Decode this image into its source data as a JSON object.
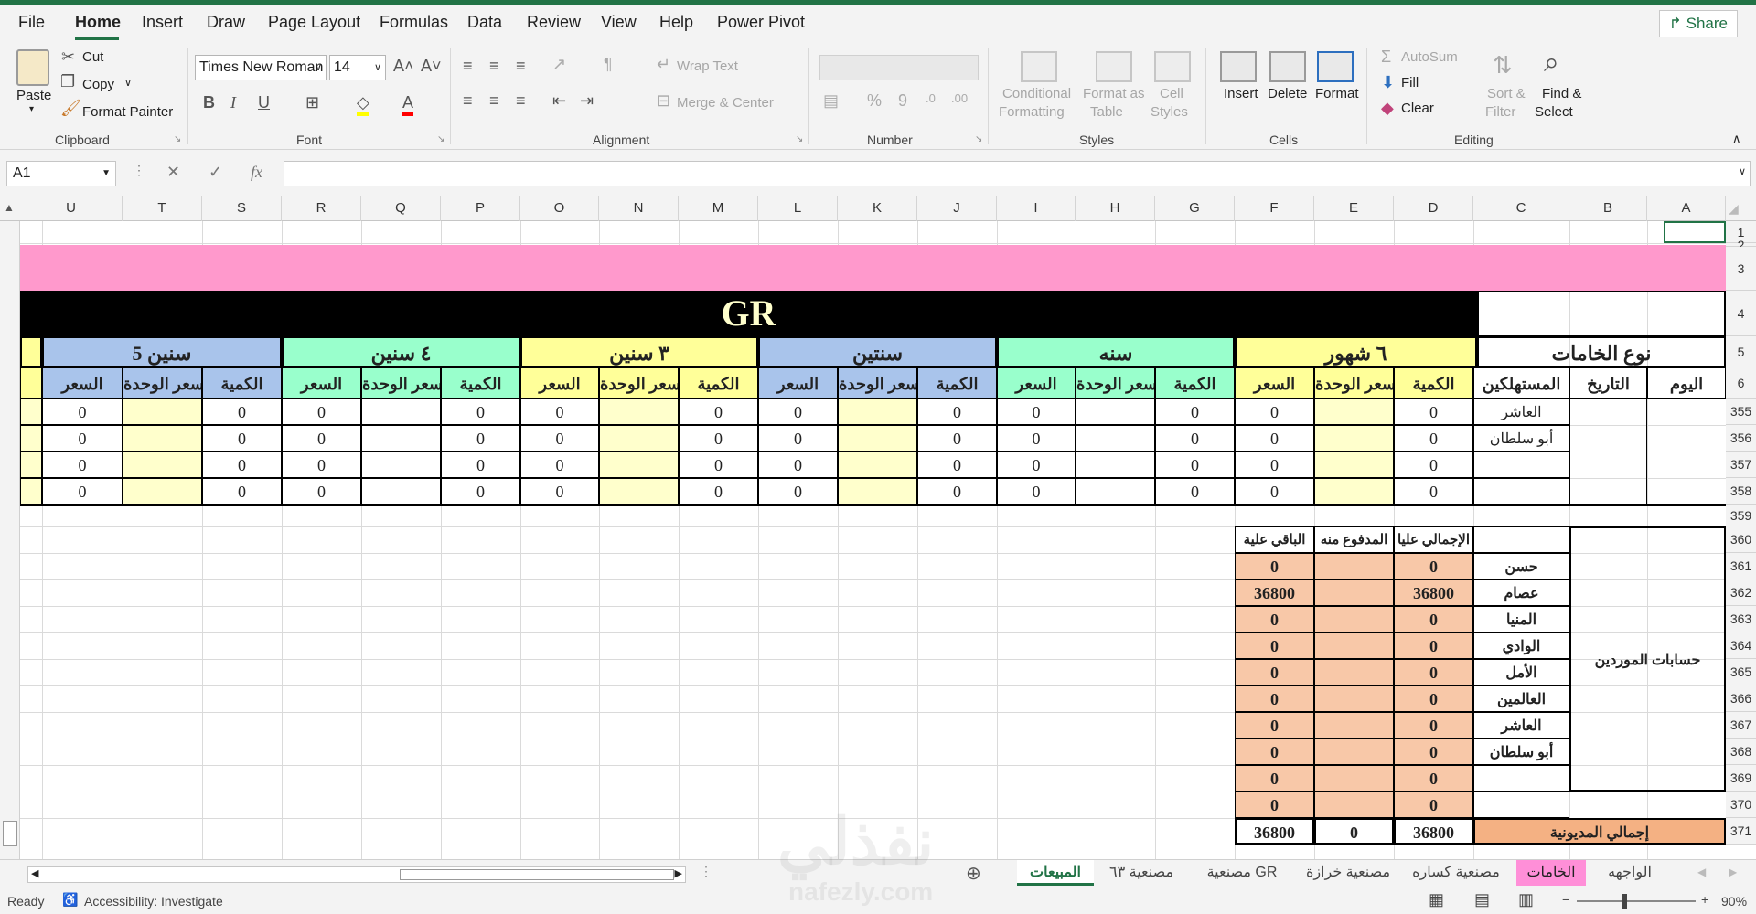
{
  "menu": {
    "items": [
      "File",
      "Home",
      "Insert",
      "Draw",
      "Page Layout",
      "Formulas",
      "Data",
      "Review",
      "View",
      "Help",
      "Power Pivot"
    ],
    "active": "Home",
    "share_label": "Share"
  },
  "ribbon": {
    "clipboard": {
      "paste": "Paste",
      "cut": "Cut",
      "copy": "Copy",
      "format_painter": "Format Painter",
      "label": "Clipboard"
    },
    "font": {
      "name": "Times New Roman",
      "size": "14",
      "label": "Font"
    },
    "alignment": {
      "wrap_text": "Wrap Text",
      "merge_center": "Merge & Center",
      "label": "Alignment"
    },
    "number": {
      "label": "Number"
    },
    "styles": {
      "conditional": "Conditional",
      "conditional2": "Formatting",
      "format_as": "Format as",
      "format_as2": "Table",
      "cell": "Cell",
      "cell2": "Styles",
      "label": "Styles"
    },
    "cells": {
      "insert": "Insert",
      "delete": "Delete",
      "format": "Format",
      "label": "Cells"
    },
    "editing": {
      "autosum": "AutoSum",
      "fill": "Fill",
      "clear": "Clear",
      "sort": "Sort &",
      "sort2": "Filter",
      "find": "Find &",
      "find2": "Select",
      "label": "Editing"
    }
  },
  "formula_bar": {
    "name_box": "A1",
    "formula": ""
  },
  "columns": [
    "U",
    "T",
    "S",
    "R",
    "Q",
    "P",
    "O",
    "N",
    "M",
    "L",
    "K",
    "J",
    "I",
    "H",
    "G",
    "F",
    "E",
    "D",
    "C",
    "B",
    "A"
  ],
  "rows": [
    "1",
    "2",
    "3",
    "4",
    "5",
    "6",
    "355",
    "356",
    "357",
    "358",
    "359",
    "360",
    "361",
    "362",
    "363",
    "364",
    "365",
    "366",
    "367",
    "368",
    "369",
    "370",
    "371"
  ],
  "sheet": {
    "title": "GR",
    "groups": [
      "٦ شهور",
      "سنه",
      "سنتين",
      "٣ سنين",
      "٤ سنين",
      "سنين 5"
    ],
    "raw_types_header": "نوع الخامات",
    "sub_headers": {
      "qty": "الكمية",
      "unit_price": "سعر الوحدة",
      "price": "السعر"
    },
    "left_headers": {
      "consumers": "المستهلكين",
      "date": "التاريخ",
      "day": "اليوم"
    },
    "data_rows": [
      {
        "name": "العاشر",
        "vals": [
          "0",
          "0",
          "0",
          "0",
          "0",
          "0",
          "0",
          "0",
          "0",
          "0",
          "0",
          "0"
        ]
      },
      {
        "name": "أبو سلطان",
        "vals": [
          "0",
          "0",
          "0",
          "0",
          "0",
          "0",
          "0",
          "0",
          "0",
          "0",
          "0",
          "0"
        ]
      },
      {
        "name": "",
        "vals": [
          "0",
          "0",
          "0",
          "0",
          "0",
          "0",
          "0",
          "0",
          "0",
          "0",
          "0",
          "0"
        ]
      },
      {
        "name": "",
        "vals": [
          "0",
          "0",
          "0",
          "0",
          "0",
          "0",
          "0",
          "0",
          "0",
          "0",
          "0",
          "0"
        ]
      }
    ],
    "suppliers": {
      "section_label": "حسابات الموردين",
      "headers": [
        "الإجمالي عليا",
        "المدفوع منه",
        "الباقي علية"
      ],
      "rows": [
        {
          "name": "حسن",
          "total": "0",
          "paid": "",
          "remaining": "0"
        },
        {
          "name": "عصام",
          "total": "36800",
          "paid": "",
          "remaining": "36800"
        },
        {
          "name": "المنيا",
          "total": "0",
          "paid": "",
          "remaining": "0"
        },
        {
          "name": "الوادي",
          "total": "0",
          "paid": "",
          "remaining": "0"
        },
        {
          "name": "الأمل",
          "total": "0",
          "paid": "",
          "remaining": "0"
        },
        {
          "name": "العالمين",
          "total": "0",
          "paid": "",
          "remaining": "0"
        },
        {
          "name": "العاشر",
          "total": "0",
          "paid": "",
          "remaining": "0"
        },
        {
          "name": "أبو سلطان",
          "total": "0",
          "paid": "",
          "remaining": "0"
        },
        {
          "name": "",
          "total": "0",
          "paid": "",
          "remaining": "0"
        },
        {
          "name": "",
          "total": "0",
          "paid": "",
          "remaining": "0"
        }
      ],
      "total_label": "إجمالي المديونية",
      "total": {
        "total": "36800",
        "paid": "0",
        "remaining": "36800"
      }
    }
  },
  "tabs": [
    "المبيعات",
    "مصنعية ٦٣",
    "مصنعية GR",
    "مصنعية خرازة",
    "مصنعية كساره",
    "الخامات",
    "الواجهه"
  ],
  "active_tab": "المبيعات",
  "status": {
    "ready": "Ready",
    "accessibility": "Accessibility: Investigate",
    "zoom": "90%"
  },
  "watermark": {
    "text": "نفذلي",
    "url": "nafezly.com"
  },
  "colors": {
    "pink": "#ff99cc",
    "black": "#000000",
    "yellow": "#ffff99",
    "green": "#99ffcc",
    "blue": "#a9c4eb",
    "peach": "#f8c8a8",
    "orange": "#f4b183",
    "light_yellow": "#ffffcc",
    "excel_green": "#217346"
  }
}
